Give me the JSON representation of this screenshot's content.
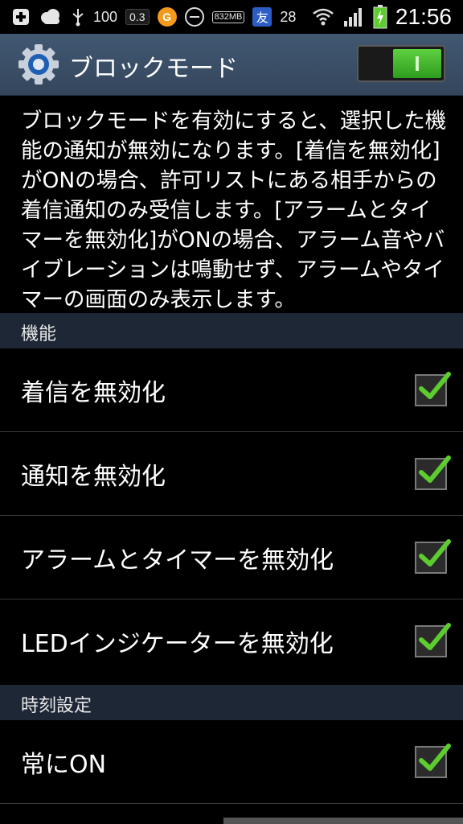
{
  "status_bar": {
    "battery_level": "100",
    "data_rate": "0.3",
    "storage": "832",
    "storage_unit": "MB",
    "tomo_label": "友",
    "temp": "28",
    "time": "21:56"
  },
  "header": {
    "title": "ブロックモード",
    "master_switch_on": true
  },
  "description": "ブロックモードを有効にすると、選択した機能の通知が無効になります。[着信を無効化]がONの場合、許可リストにある相手からの着信通知のみ受信します。[アラームとタイマーを無効化]がONの場合、アラーム音やバイブレーションは鳴動せず、アラームやタイマーの画面のみ表示します。",
  "sections": {
    "features": {
      "title": "機能",
      "items": [
        {
          "label": "着信を無効化",
          "checked": true
        },
        {
          "label": "通知を無効化",
          "checked": true
        },
        {
          "label": "アラームとタイマーを無効化",
          "checked": true
        },
        {
          "label": "LEDインジケーターを無効化",
          "checked": true
        }
      ]
    },
    "time_settings": {
      "title": "時刻設定",
      "items": [
        {
          "label": "常にON",
          "checked": true
        }
      ]
    }
  },
  "colors": {
    "header_bg": "#3b4e66",
    "section_bg": "#1d2735",
    "check_green": "#5ccc2e",
    "switch_green": "#4cc232"
  }
}
